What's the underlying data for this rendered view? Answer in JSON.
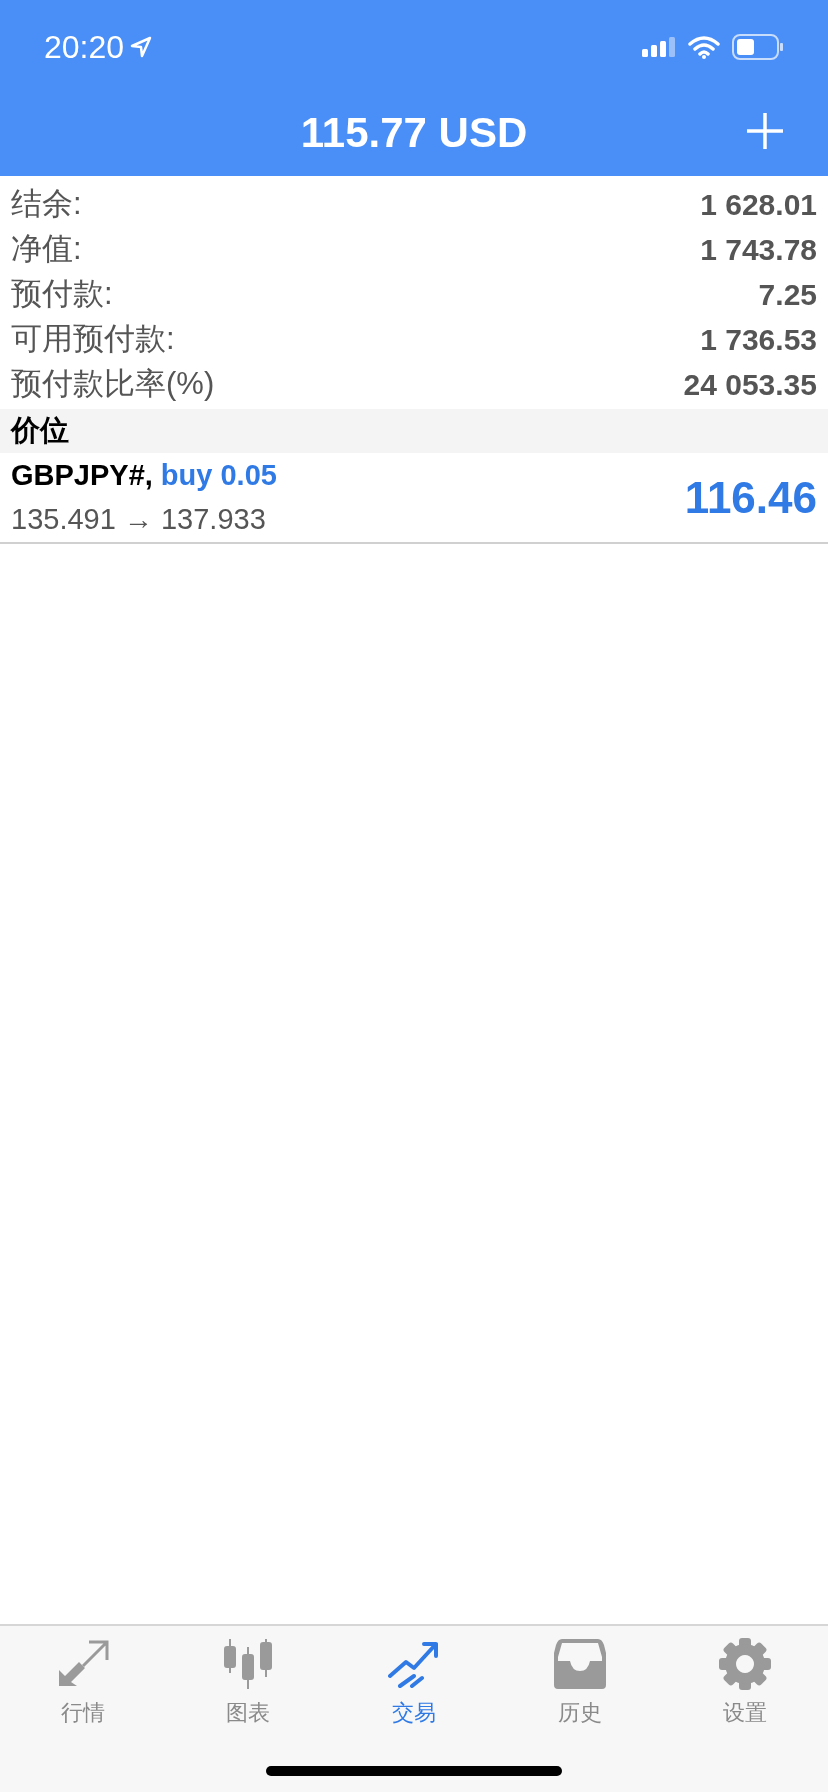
{
  "status_bar": {
    "time": "20:20"
  },
  "header": {
    "title": "115.77 USD"
  },
  "account": [
    {
      "label": "结余:",
      "value": "1 628.01"
    },
    {
      "label": "净值:",
      "value": "1 743.78"
    },
    {
      "label": "预付款:",
      "value": "7.25"
    },
    {
      "label": "可用预付款:",
      "value": "1 736.53"
    },
    {
      "label": "预付款比率(%)",
      "value": "24 053.35"
    }
  ],
  "section": {
    "title": "价位"
  },
  "positions": [
    {
      "symbol": "GBPJPY#,",
      "order": "buy 0.05",
      "prices": "135.491 → 137.933",
      "profit": "116.46"
    }
  ],
  "tabs": [
    {
      "kind": "quotes",
      "label": "行情",
      "selected": false
    },
    {
      "kind": "chart",
      "label": "图表",
      "selected": false
    },
    {
      "kind": "trade",
      "label": "交易",
      "selected": true
    },
    {
      "kind": "history",
      "label": "历史",
      "selected": false
    },
    {
      "kind": "settings",
      "label": "设置",
      "selected": false
    }
  ]
}
